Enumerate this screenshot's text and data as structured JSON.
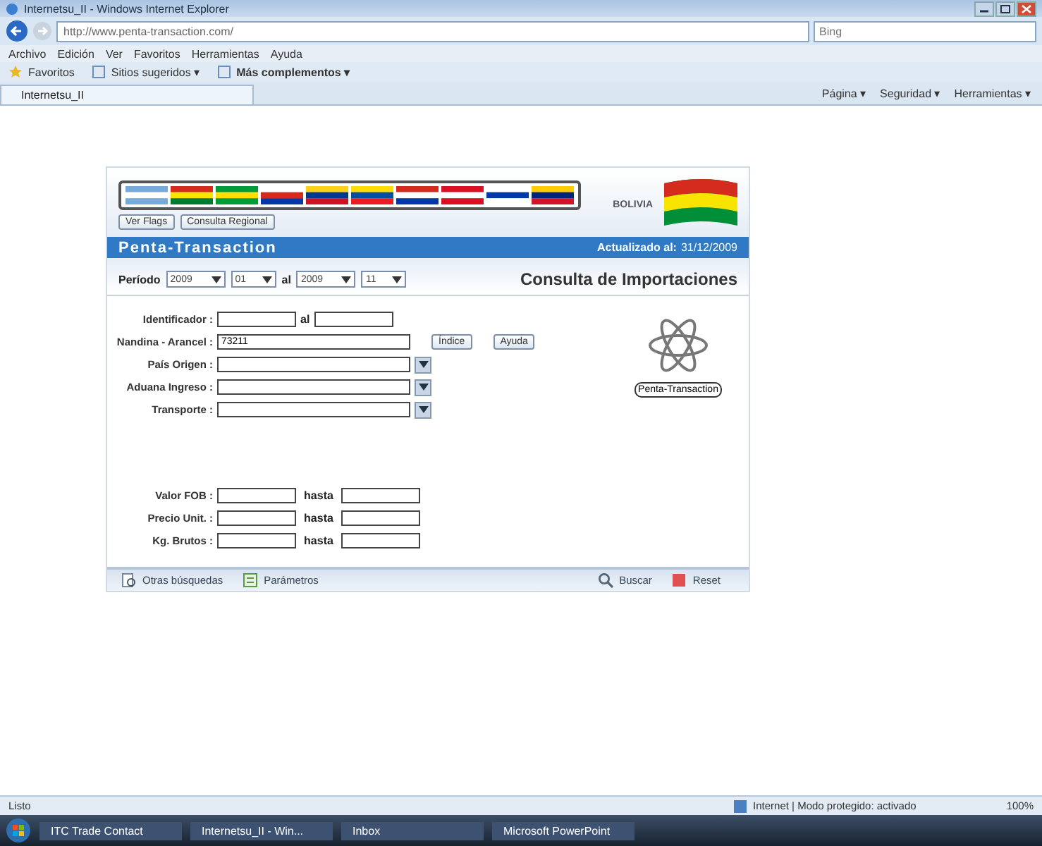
{
  "window": {
    "title": "Internetsu_II - Windows Internet Explorer"
  },
  "address_bar": {
    "url": "http://www.penta-transaction.com/",
    "search_placeholder": "Bing"
  },
  "menu": [
    "Archivo",
    "Edición",
    "Ver",
    "Favoritos",
    "Herramientas",
    "Ayuda"
  ],
  "favorites_bar": [
    "Favoritos",
    "Sitios sugeridos ▾",
    "Más complementos ▾"
  ],
  "tab": {
    "title": "Internetsu_II"
  },
  "command_bar": [
    "Página ▾",
    "Seguridad ▾",
    "Herramientas ▾"
  ],
  "page": {
    "header_buttons": [
      "Ver Flags",
      "Consulta Regional"
    ],
    "country": "BOLIVIA",
    "brand": "Penta-Transaction",
    "updated_label": "Actualizado al:",
    "updated_date": "31/12/2009",
    "period": {
      "label": "Período",
      "from_year": "2009",
      "from_month": "01",
      "to_label": "al",
      "to_year": "2009",
      "to_month": "11"
    },
    "heading": "Consulta de Importaciones",
    "fields": [
      {
        "kind": "range",
        "label": "Identificador :",
        "to_label": "al"
      },
      {
        "kind": "text_buttons",
        "label": "Nandina - Arancel :",
        "value": "73211",
        "buttons": [
          "Índice",
          "Ayuda"
        ]
      },
      {
        "kind": "picker",
        "label": "País Origen :"
      },
      {
        "kind": "picker",
        "label": "Aduana Ingreso :"
      },
      {
        "kind": "picker",
        "label": "Transporte :"
      }
    ],
    "ranges": [
      {
        "label": "Valor FOB :",
        "to_label": "hasta"
      },
      {
        "label": "Precio Unit. :",
        "to_label": "hasta"
      },
      {
        "label": "Kg. Brutos :",
        "to_label": "hasta"
      }
    ],
    "logo_button": "Penta-Transaction",
    "footer_left": [
      "Otras búsquedas",
      "Parámetros"
    ],
    "footer_right": [
      "Buscar",
      "Reset"
    ]
  },
  "status_bar": {
    "text": "Listo",
    "zone": "Internet | Modo protegido: activado",
    "zoom": "100%"
  },
  "taskbar": [
    "ITC Trade Contact",
    "Internetsu_II - Win...",
    "Inbox",
    "Microsoft PowerPoint"
  ]
}
